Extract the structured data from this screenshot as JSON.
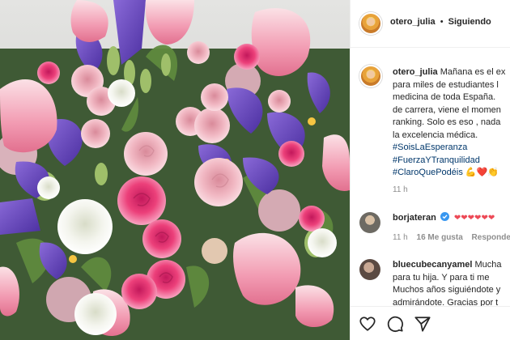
{
  "header": {
    "username": "otero_julia",
    "separator": "•",
    "follow_status": "Siguiendo"
  },
  "caption": {
    "username": "otero_julia",
    "lines": [
      "Mañana es el ex",
      "para miles de estudiantes l",
      "medicina de toda España. ",
      "de carrera, viene el momen",
      "ranking. Solo es eso , nada",
      "la excelencia médica."
    ],
    "hashtags": [
      "#SoisLaEsperanza",
      "#FuerzaYTranquilidad",
      "#ClaroQuePodéis"
    ],
    "emojis": "💪❤️👏",
    "time": "11 h"
  },
  "comments": [
    {
      "username": "borjateran",
      "text": "❤❤❤❤❤❤",
      "time": "11 h",
      "likes": "16 Me gusta",
      "reply": "Responde"
    },
    {
      "username": "bluecubecanyamel",
      "lines": [
        "Mucha",
        "para tu hija. Y para ti me",
        "Muchos años siguiéndote y",
        "admirándote. Gracias por t"
      ]
    }
  ],
  "actions": {
    "like_icon": "heart-outline-icon",
    "comment_icon": "speech-bubble-icon",
    "share_icon": "paper-plane-icon",
    "save_icon": "bookmark-icon"
  },
  "colors": {
    "link": "#00376b",
    "muted": "#8e8e8e",
    "verified": "#3897f0",
    "heart": "#ed4956"
  }
}
